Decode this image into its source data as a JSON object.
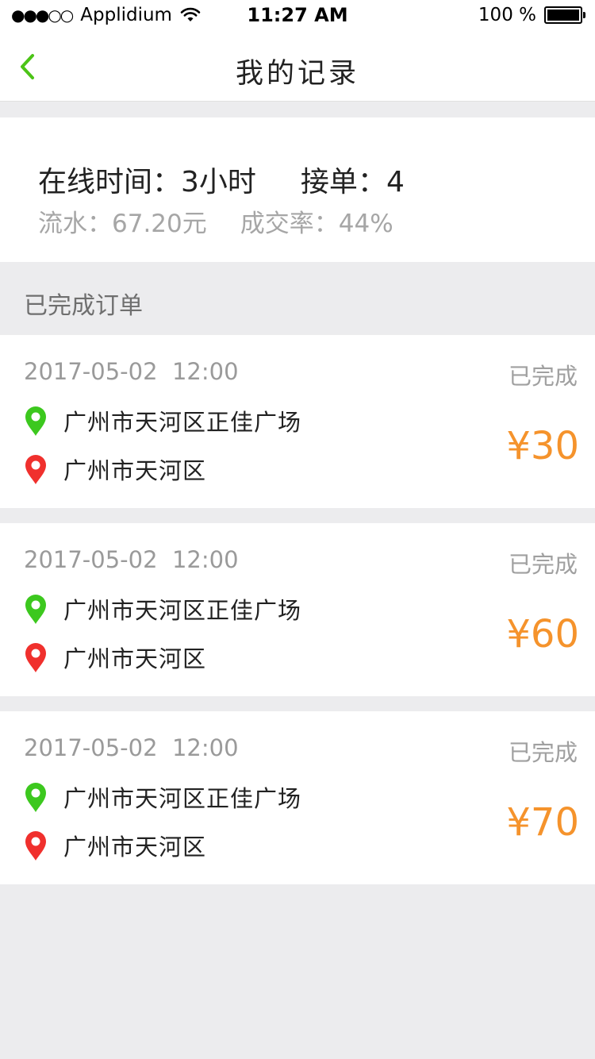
{
  "status_bar": {
    "signal": "●●●○○",
    "carrier": "Applidium",
    "time": "11:27 AM",
    "battery_text": "100 %",
    "battery_level": 1.0
  },
  "nav": {
    "back_icon": "chevron-left-icon",
    "title": "我的记录"
  },
  "summary": {
    "online_label": "在线时间：",
    "online_value": "3小时",
    "orders_label": "接单：",
    "orders_value": "4",
    "revenue_label": "流水：",
    "revenue_value": "67.20元",
    "rate_label": "成交率：",
    "rate_value": "44%"
  },
  "section": {
    "title": "已完成订单"
  },
  "colors": {
    "accent_green": "#4cc417",
    "origin_pin": "#3cc81e",
    "destination_pin": "#f0302d",
    "price_orange": "#f5932c"
  },
  "orders": [
    {
      "date": "2017-05-02",
      "time": "12:00",
      "status": "已完成",
      "from": "广州市天河区正佳广场",
      "to": "广州市天河区",
      "price": "¥30"
    },
    {
      "date": "2017-05-02",
      "time": "12:00",
      "status": "已完成",
      "from": "广州市天河区正佳广场",
      "to": "广州市天河区",
      "price": "¥60"
    },
    {
      "date": "2017-05-02",
      "time": "12:00",
      "status": "已完成",
      "from": "广州市天河区正佳广场",
      "to": "广州市天河区",
      "price": "¥70"
    }
  ]
}
